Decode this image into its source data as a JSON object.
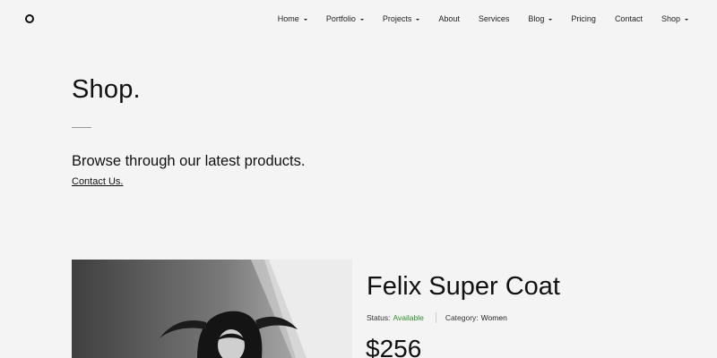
{
  "header": {
    "logo_icon": "circle-logo-icon",
    "nav": [
      {
        "label": "Home",
        "dropdown": true
      },
      {
        "label": "Portfolio",
        "dropdown": true
      },
      {
        "label": "Projects",
        "dropdown": true
      },
      {
        "label": "About",
        "dropdown": false
      },
      {
        "label": "Services",
        "dropdown": false
      },
      {
        "label": "Blog",
        "dropdown": true
      },
      {
        "label": "Pricing",
        "dropdown": false
      },
      {
        "label": "Contact",
        "dropdown": false
      },
      {
        "label": "Shop",
        "dropdown": true
      }
    ]
  },
  "hero": {
    "title": "Shop.",
    "subtitle": "Browse through our latest products.",
    "link": "Contact Us."
  },
  "product": {
    "title": "Felix Super Coat",
    "status_label": "Status:",
    "status_value": "Available",
    "category_label": "Category:",
    "category_value": "Women",
    "price": "$256"
  },
  "colors": {
    "background": "#f4f4f4",
    "text": "#111111",
    "status_available": "#2e8b2e"
  }
}
